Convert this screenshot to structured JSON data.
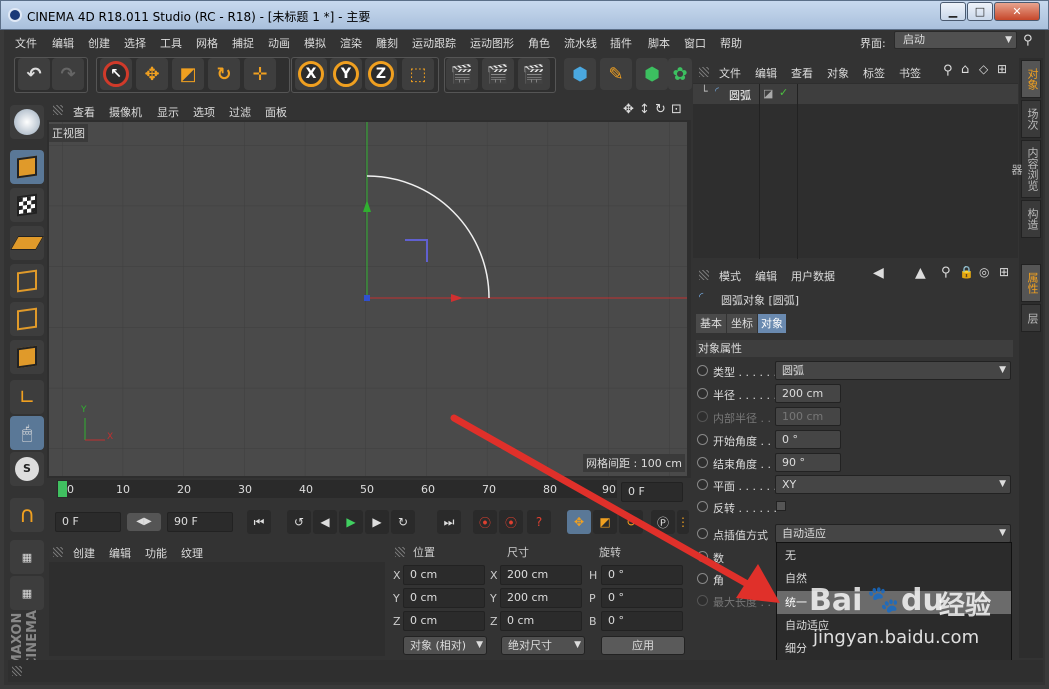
{
  "window": {
    "title": "CINEMA 4D R18.011 Studio (RC - R18) - [未标题 1 *] - 主要",
    "min": "▁",
    "max": "□",
    "close": "✕"
  },
  "menubar": {
    "items": [
      "文件",
      "编辑",
      "创建",
      "选择",
      "工具",
      "网格",
      "捕捉",
      "动画",
      "模拟",
      "渲染",
      "雕刻",
      "运动跟踪",
      "运动图形",
      "角色",
      "流水线",
      "插件",
      "脚本",
      "窗口",
      "帮助"
    ],
    "layout_label": "界面:",
    "layout_value": "启动"
  },
  "viewport": {
    "menu": [
      "查看",
      "摄像机",
      "显示",
      "选项",
      "过滤",
      "面板"
    ],
    "view_name": "正视图",
    "grid_label": "网格间距 : 100 cm",
    "axis_y": "Y",
    "axis_x": "X"
  },
  "timeline": {
    "ticks": [
      "0",
      "10",
      "20",
      "30",
      "40",
      "50",
      "60",
      "70",
      "80",
      "90"
    ],
    "end_field": "0 F"
  },
  "anim": {
    "start": "0 F",
    "end": "90 F"
  },
  "material": {
    "menu": [
      "创建",
      "编辑",
      "功能",
      "纹理"
    ]
  },
  "coords": {
    "headers": [
      "位置",
      "尺寸",
      "旋转"
    ],
    "rows": [
      {
        "a": "X",
        "av": "0 cm",
        "b": "X",
        "bv": "200 cm",
        "c": "H",
        "cv": "0 °"
      },
      {
        "a": "Y",
        "av": "0 cm",
        "b": "Y",
        "bv": "200 cm",
        "c": "P",
        "cv": "0 °"
      },
      {
        "a": "Z",
        "av": "0 cm",
        "b": "Z",
        "bv": "0 cm",
        "c": "B",
        "cv": "0 °"
      }
    ],
    "mode": "对象 (相对)",
    "size_mode": "绝对尺寸",
    "apply": "应用"
  },
  "objmgr": {
    "menu": [
      "文件",
      "编辑",
      "查看",
      "对象",
      "标签",
      "书签"
    ],
    "object_name": "圆弧"
  },
  "attr": {
    "menu": [
      "模式",
      "编辑",
      "用户数据"
    ],
    "header": "圆弧对象 [圆弧]",
    "tabs": [
      "基本",
      "坐标",
      "对象"
    ],
    "section": "对象属性",
    "props": [
      {
        "label": "类型 . . . . . .",
        "value": "圆弧"
      },
      {
        "label": "半径 . . . . . .",
        "value": "200 cm"
      },
      {
        "label": "内部半径 . .",
        "value": "100 cm"
      },
      {
        "label": "开始角度 . .",
        "value": "0 °"
      },
      {
        "label": "结束角度 . .",
        "value": "90 °"
      },
      {
        "label": "平面 . . . . . .",
        "value": "XY"
      },
      {
        "label": "反转 . . . . . .",
        "value": ""
      },
      {
        "label": "点插值方式",
        "value": "自动适应"
      },
      {
        "label": "数",
        "value": ""
      },
      {
        "label": "角",
        "value": ""
      },
      {
        "label": "最大长度 . .",
        "value": ""
      }
    ],
    "dropdown_options": [
      "无",
      "自然",
      "统一",
      "自动适应",
      "细分"
    ],
    "dropdown_selected": "统一"
  },
  "sidetabs": [
    "对象",
    "场次",
    "内容浏览器",
    "构造",
    "属性",
    "层"
  ],
  "watermark": {
    "brand": "Bai",
    "brand2": "du",
    "text": "经验",
    "url": "jingyan.baidu.com"
  },
  "colors": {
    "accent": "#f0a020",
    "arrow": "#e0302a",
    "x_axis": "#d03030",
    "y_axis": "#30b030"
  }
}
